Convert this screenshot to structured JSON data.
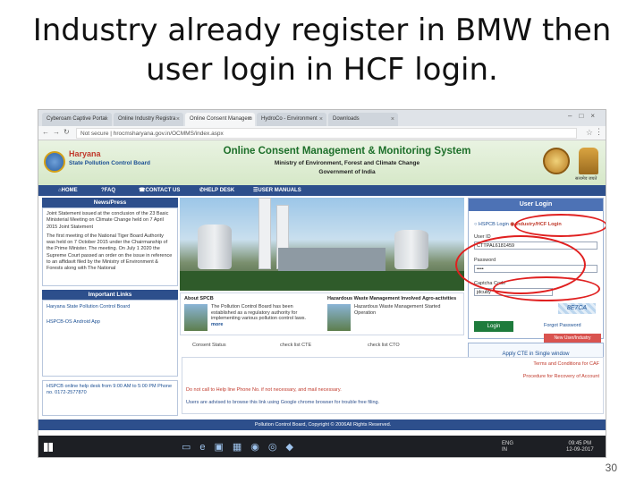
{
  "slide": {
    "title_line1": "Industry already register in BMW then",
    "title_line2": "user login in HCF login.",
    "page_number": "30"
  },
  "browser": {
    "tabs": [
      {
        "label": "Cyberoam Captive Portal",
        "active": false
      },
      {
        "label": "Online Industry Registra",
        "active": false
      },
      {
        "label": "Online Consent Managem",
        "active": true
      },
      {
        "label": "HydroCo - Environment",
        "active": false
      },
      {
        "label": "Downloads",
        "active": false
      }
    ],
    "url": "Not secure | hrocmsharyana.gov.in/OCMMS/index.aspx"
  },
  "header": {
    "state": "Haryana",
    "board": "State Pollution Control Board",
    "system_title": "Online Consent Management & Monitoring System",
    "ministry": "Ministry of Environment, Forest and Climate Change",
    "government": "Government of India",
    "emblem_caption": "सत्यमेव जयते"
  },
  "nav": {
    "items": [
      "HOME",
      "FAQ",
      "CONTACT US",
      "HELP DESK",
      "USER MANUALS"
    ]
  },
  "news": {
    "heading": "News/Press",
    "p1": "Joint Statement issued at the conclusion of the 23 Basic Ministerial Meeting on Climate Change held on 7 April 2015 Joint Statement",
    "p2": "The first meeting of the National Tiger Board Authority was held on 7 October 2015 under the Chairmanship of the Prime Minister. The meeting. On July 1 2020 the Supreme Court passed an order on the issue in reference to an affidavit filed by the Ministry of Environment & Forests along with The National"
  },
  "links": {
    "heading": "Important Links",
    "items": [
      "Haryana State Pollution Control Board",
      "HSPCB-OS Android App"
    ]
  },
  "helpline": {
    "text": "HSPCB online help desk from 9:00 AM to 5:00 PM Phone no. 0172-2577870"
  },
  "about": {
    "heading1": "About SPCB",
    "text1": "The Pollution Control Board has been established as a regulatory authority for implementing various pollution control laws.",
    "more": "more",
    "heading2": "Hazardous Waste Management Involved Agro-activities",
    "text2": "Hazardous Waste Management Started Operation"
  },
  "checklists": [
    "Consent Status",
    "check list CTE",
    "check list CTO"
  ],
  "login": {
    "heading": "User Login",
    "radio_spcb": "HSPCB Login",
    "radio_industry": "Industry/HCF Login",
    "username_label": "User ID",
    "username_value": "CTTPAL6181459",
    "password_label": "Password",
    "password_value": "••••",
    "captcha_label": "Captcha Code",
    "captcha_value": "jdcuby",
    "captcha_image_text": "8E7CA",
    "login_button": "Login",
    "forgot": "Forgot Password",
    "new_registration": "New User/Industry Registration"
  },
  "apply_cte": "Apply CTE in Single window",
  "info": {
    "terms": "Terms and Conditions for CAF",
    "procedure": "Procedure for Recovery of Account",
    "call_note": "Do not call to Help line Phone No. if not necessary, and mail necessary.",
    "browser_note": "Users are advised to browse this link using Google chrome browser for trouble free filing."
  },
  "footer": "Pollution Control Board, Copyright © 2006All Rights Reserved.",
  "taskbar": {
    "lang": "ENG",
    "region": "IN",
    "time": "09:45 PM",
    "date": "12-09-2017"
  }
}
